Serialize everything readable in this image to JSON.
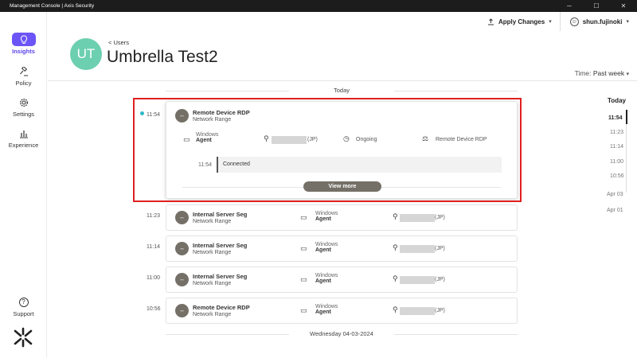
{
  "window": {
    "title": "Management Console | Axis Security",
    "minimize": "─",
    "maximize": "☐",
    "close": "✕"
  },
  "sidebar": {
    "items": [
      {
        "label": "Insights",
        "icon": "lightbulb-icon",
        "glyph": "💡"
      },
      {
        "label": "Policy",
        "icon": "gavel-icon",
        "glyph": "⚖"
      },
      {
        "label": "Settings",
        "icon": "gear-icon",
        "glyph": "⚙"
      },
      {
        "label": "Experience",
        "icon": "bar-chart-icon",
        "glyph": "▥"
      }
    ],
    "support": {
      "label": "Support",
      "glyph": "?"
    }
  },
  "header": {
    "apply_label": "Apply Changes",
    "user_name": "shun.fujinoki",
    "back_label": "< Users",
    "avatar_initials": "UT",
    "page_title": "Umbrella Test2",
    "time_label": "Time:",
    "time_value": "Past week"
  },
  "timeline": {
    "today_label": "Today",
    "previous_day_label": "Wednesday 04-03-2024"
  },
  "time_nav": {
    "heading": "Today",
    "times": [
      "11:54",
      "11:23",
      "11:14",
      "11:00",
      "10:56"
    ],
    "dates": [
      "Apr 03",
      "Apr 01"
    ]
  },
  "expanded": {
    "time": "11:54",
    "name": "Remote Device RDP",
    "sub": "Network Range",
    "os": "Windows",
    "client": "Agent",
    "country": "(JP)",
    "status": "Ongoing",
    "resource": "Remote Device RDP",
    "log_time": "11:54",
    "log_text": "Connected",
    "view_more": "View more"
  },
  "sessions": [
    {
      "time": "11:23",
      "name": "Internal Server Seg",
      "sub": "Network Range",
      "os": "Windows",
      "client": "Agent",
      "country": "(JP)"
    },
    {
      "time": "11:14",
      "name": "Internal Server Seg",
      "sub": "Network Range",
      "os": "Windows",
      "client": "Agent",
      "country": "(JP)"
    },
    {
      "time": "11:00",
      "name": "Internal Server Seg",
      "sub": "Network Range",
      "os": "Windows",
      "client": "Agent",
      "country": "(JP)"
    },
    {
      "time": "10:56",
      "name": "Remote Device RDP",
      "sub": "Network Range",
      "os": "Windows",
      "client": "Agent",
      "country": "(JP)"
    }
  ],
  "colors": {
    "accent": "#6c55f6",
    "avatar": "#6ccfb0",
    "highlight": "#e02020",
    "ongoing_dot": "#2eb8c9"
  }
}
